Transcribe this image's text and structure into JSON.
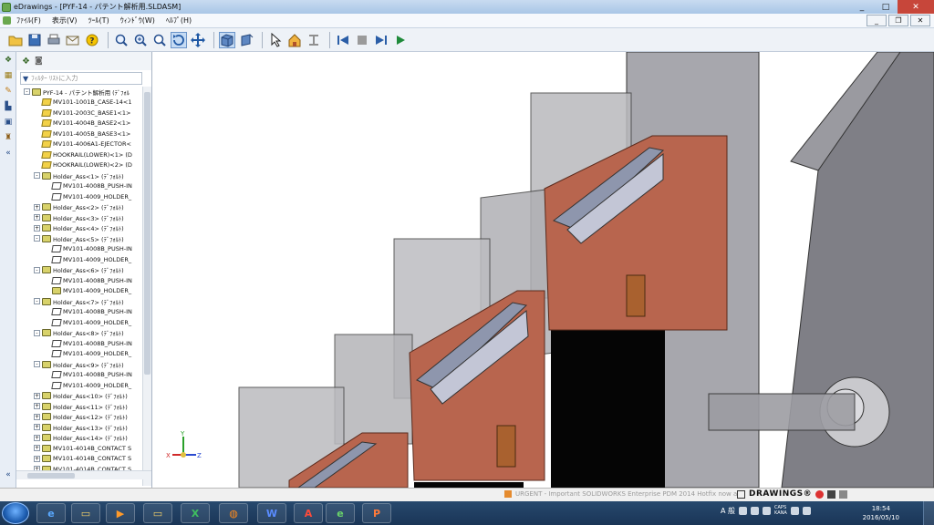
{
  "window": {
    "title": "eDrawings - [PYF-14 - パテント解析用.SLDASM]",
    "controls": [
      "_",
      "□",
      "✕"
    ]
  },
  "menu": {
    "items": [
      "ﾌｧｲﾙ(F)",
      "表示(V)",
      "ﾂｰﾙ(T)",
      "ｳｨﾝﾄﾞｳ(W)",
      "ﾍﾙﾌﾟ(H)"
    ],
    "mdi_controls": [
      "_",
      "❐",
      "✕"
    ]
  },
  "toolbar": {
    "icons": [
      "open-icon",
      "save-icon",
      "print-icon",
      "send-icon",
      "help-icon",
      "zoom-fit-icon",
      "zoom-area-icon",
      "zoom-icon",
      "rotate-icon",
      "pan-icon",
      "view-box-icon",
      "view-orient-icon",
      "select-icon",
      "home-icon",
      "explode-icon",
      "first-frame-icon",
      "stop-icon",
      "next-frame-icon",
      "play-icon"
    ]
  },
  "panel": {
    "filter_placeholder": "ﾌｨﾙﾀｰ ﾘｽﾄに入力",
    "tree": [
      {
        "label": "PYF-14 - パテント解析用 (ﾃﾞﾌｫﾙ",
        "level": 0,
        "expander": "-",
        "icon": "asm"
      },
      {
        "label": "MV101-1001B_CASE-14<1",
        "level": 1,
        "expander": "",
        "icon": "part"
      },
      {
        "label": "MV101-2003C_BASE1<1>",
        "level": 1,
        "expander": "",
        "icon": "part"
      },
      {
        "label": "MV101-4004B_BASE2<1>",
        "level": 1,
        "expander": "",
        "icon": "part"
      },
      {
        "label": "MV101-4005B_BASE3<1>",
        "level": 1,
        "expander": "",
        "icon": "part"
      },
      {
        "label": "MV101-4006A1-EJECTOR<",
        "level": 1,
        "expander": "",
        "icon": "part"
      },
      {
        "label": "HOOKRAIL(LOWER)<1> (D",
        "level": 1,
        "expander": "",
        "icon": "part"
      },
      {
        "label": "HOOKRAIL(LOWER)<2> (D",
        "level": 1,
        "expander": "",
        "icon": "part"
      },
      {
        "label": "Holder_Ass<1> (ﾃﾞﾌｫﾙﾄ)",
        "level": 1,
        "expander": "-",
        "icon": "asm"
      },
      {
        "label": "MV101-4008B_PUSH-IN",
        "level": 2,
        "expander": "",
        "icon": "sub"
      },
      {
        "label": "MV101-4009_HOLDER_",
        "level": 2,
        "expander": "",
        "icon": "sub"
      },
      {
        "label": "Holder_Ass<2> (ﾃﾞﾌｫﾙﾄ)",
        "level": 1,
        "expander": "+",
        "icon": "asm"
      },
      {
        "label": "Holder_Ass<3> (ﾃﾞﾌｫﾙﾄ)",
        "level": 1,
        "expander": "+",
        "icon": "asm"
      },
      {
        "label": "Holder_Ass<4> (ﾃﾞﾌｫﾙﾄ)",
        "level": 1,
        "expander": "+",
        "icon": "asm"
      },
      {
        "label": "Holder_Ass<5> (ﾃﾞﾌｫﾙﾄ)",
        "level": 1,
        "expander": "-",
        "icon": "asm"
      },
      {
        "label": "MV101-4008B_PUSH-IN",
        "level": 2,
        "expander": "",
        "icon": "sub"
      },
      {
        "label": "MV101-4009_HOLDER_",
        "level": 2,
        "expander": "",
        "icon": "sub"
      },
      {
        "label": "Holder_Ass<6> (ﾃﾞﾌｫﾙﾄ)",
        "level": 1,
        "expander": "-",
        "icon": "asm"
      },
      {
        "label": "MV101-4008B_PUSH-IN",
        "level": 2,
        "expander": "",
        "icon": "sub"
      },
      {
        "label": "MV101-4009_HOLDER_",
        "level": 2,
        "expander": "",
        "icon": "asm"
      },
      {
        "label": "Holder_Ass<7> (ﾃﾞﾌｫﾙﾄ)",
        "level": 1,
        "expander": "-",
        "icon": "asm"
      },
      {
        "label": "MV101-4008B_PUSH-IN",
        "level": 2,
        "expander": "",
        "icon": "sub"
      },
      {
        "label": "MV101-4009_HOLDER_",
        "level": 2,
        "expander": "",
        "icon": "sub"
      },
      {
        "label": "Holder_Ass<8> (ﾃﾞﾌｫﾙﾄ)",
        "level": 1,
        "expander": "-",
        "icon": "asm"
      },
      {
        "label": "MV101-4008B_PUSH-IN",
        "level": 2,
        "expander": "",
        "icon": "sub"
      },
      {
        "label": "MV101-4009_HOLDER_",
        "level": 2,
        "expander": "",
        "icon": "sub"
      },
      {
        "label": "Holder_Ass<9> (ﾃﾞﾌｫﾙﾄ)",
        "level": 1,
        "expander": "-",
        "icon": "asm"
      },
      {
        "label": "MV101-4008B_PUSH-IN",
        "level": 2,
        "expander": "",
        "icon": "sub"
      },
      {
        "label": "MV101-4009_HOLDER_",
        "level": 2,
        "expander": "",
        "icon": "sub"
      },
      {
        "label": "Holder_Ass<10> (ﾃﾞﾌｫﾙﾄ)",
        "level": 1,
        "expander": "+",
        "icon": "asm"
      },
      {
        "label": "Holder_Ass<11> (ﾃﾞﾌｫﾙﾄ)",
        "level": 1,
        "expander": "+",
        "icon": "asm"
      },
      {
        "label": "Holder_Ass<12> (ﾃﾞﾌｫﾙﾄ)",
        "level": 1,
        "expander": "+",
        "icon": "asm"
      },
      {
        "label": "Holder_Ass<13> (ﾃﾞﾌｫﾙﾄ)",
        "level": 1,
        "expander": "+",
        "icon": "asm"
      },
      {
        "label": "Holder_Ass<14> (ﾃﾞﾌｫﾙﾄ)",
        "level": 1,
        "expander": "+",
        "icon": "asm"
      },
      {
        "label": "MV101-4014B_CONTACT S",
        "level": 1,
        "expander": "+",
        "icon": "asm"
      },
      {
        "label": "MV101-4014B_CONTACT S",
        "level": 1,
        "expander": "+",
        "icon": "asm"
      },
      {
        "label": "MV101-4014B_CONTACT S",
        "level": 1,
        "expander": "+",
        "icon": "asm"
      }
    ]
  },
  "triad": {
    "x": "X",
    "y": "Y",
    "z": "Z"
  },
  "status": {
    "message": "URGENT - Important SOLIDWORKS Enterprise PDM 2014 Hotfix now a",
    "brand": "DRAWINGS®"
  },
  "taskbar": {
    "apps": [
      "ie-icon",
      "explorer-icon",
      "media-player-icon",
      "folder-icon",
      "excel-icon",
      "app-icon",
      "word-icon",
      "acrobat-icon",
      "edrawings-icon",
      "powerpoint-icon"
    ],
    "app_glyphs": [
      "e",
      "▭",
      "▶",
      "▭",
      "X",
      "◍",
      "W",
      "A",
      "e",
      "P"
    ],
    "ime": "A 般",
    "caps": "CAPS",
    "kana": "KANA",
    "time": "18:54",
    "date": "2016/05/10"
  },
  "colors": {
    "copper": "#b8654e",
    "copper_dark": "#8e4a38",
    "steel": "#8e96ad",
    "ghost_gray": "#9c9ca2"
  }
}
